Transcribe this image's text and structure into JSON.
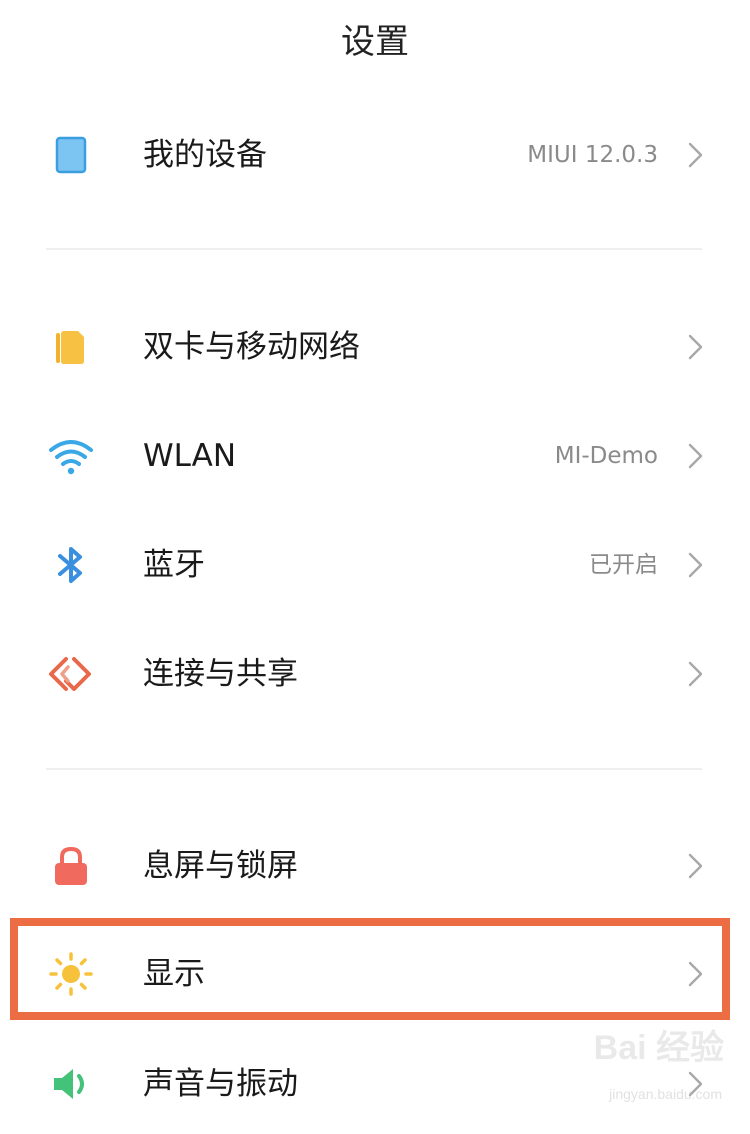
{
  "header": {
    "title": "设置"
  },
  "rows": {
    "my_device": {
      "label": "我的设备",
      "value": "MIUI 12.0.3",
      "icon": "device-icon",
      "color": "#5aaeea"
    },
    "sim": {
      "label": "双卡与移动网络",
      "value": "",
      "icon": "sim-card-icon",
      "color": "#f7c243"
    },
    "wlan": {
      "label": "WLAN",
      "value": "MI-Demo",
      "icon": "wifi-icon",
      "color": "#3aa7e6"
    },
    "bluetooth": {
      "label": "蓝牙",
      "value": "已开启",
      "icon": "bluetooth-icon",
      "color": "#3a8fde"
    },
    "connection": {
      "label": "连接与共享",
      "value": "",
      "icon": "connection-share-icon",
      "color": "#e8694a"
    },
    "lock": {
      "label": "息屏与锁屏",
      "value": "",
      "icon": "lock-icon",
      "color": "#f06a5e"
    },
    "display": {
      "label": "显示",
      "value": "",
      "icon": "sun-icon",
      "color": "#f6c23c"
    },
    "sound": {
      "label": "声音与振动",
      "value": "",
      "icon": "speaker-icon",
      "color": "#45c27a"
    }
  },
  "highlight": {
    "color": "#ec6d43",
    "target": "display"
  },
  "watermark": {
    "logo": "Bai 经验",
    "sub": "jingyan.baidu.com"
  }
}
